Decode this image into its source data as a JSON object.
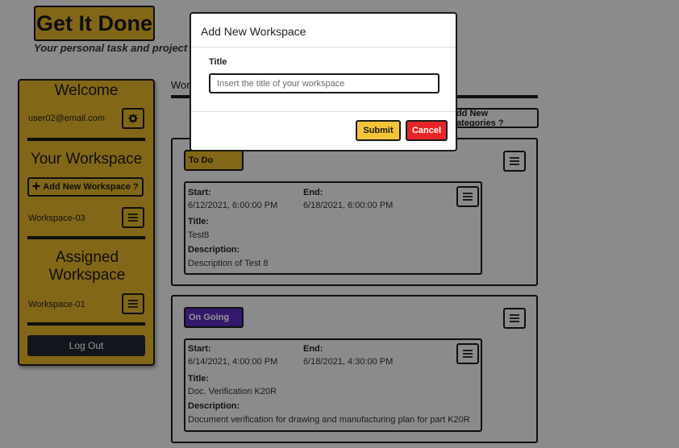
{
  "app": {
    "title": "Get It Done",
    "subtitle": "Your personal task and project management"
  },
  "sidebar": {
    "welcome_heading": "Welcome",
    "user_email": "user02@email.com",
    "your_workspace_heading": "Your Workspace",
    "add_workspace_label": "Add New Workspace ?",
    "workspaces": [
      "Workspace-03"
    ],
    "assigned_heading": "Assigned Workspace",
    "assigned_workspaces": [
      "Workspace-01"
    ],
    "logout_label": "Log Out"
  },
  "main": {
    "tab_label": "Workspace-03",
    "new_categories_label": "Add New Categories ?",
    "task_labels": {
      "start": "Start:",
      "end": "End:",
      "title": "Title:",
      "description": "Description:"
    },
    "categories": [
      {
        "name": "To Do",
        "color": "#e0b22a",
        "text_color": "#1a1a1a",
        "tasks": [
          {
            "start": "6/12/2021, 6:00:00 PM",
            "end": "6/18/2021, 6:00:00 PM",
            "title": "Test8",
            "description": "Description of Test 8"
          }
        ]
      },
      {
        "name": "On Going",
        "color": "#5a2ab8",
        "text_color": "#ffffff",
        "tasks": [
          {
            "start": "6/14/2021, 4:00:00 PM",
            "end": "6/18/2021, 4:30:00 PM",
            "title": "Doc. Verification K20R",
            "description": "Document verification for drawing and manufacturing plan for part K20R"
          }
        ]
      }
    ]
  },
  "modal": {
    "title": "Add New Workspace",
    "field_label": "Title",
    "input_placeholder": "Insert the title of your workspace",
    "input_value": "",
    "submit_label": "Submit",
    "cancel_label": "Cancel"
  },
  "icons": {
    "settings": "gear-icon",
    "menu": "hamburger-menu-icon",
    "add": "plus-icon"
  },
  "colors": {
    "brand_yellow": "#e0b22a",
    "dark": "#1d2630",
    "cancel_red": "#e52629",
    "submit_yellow": "#f3c43a"
  }
}
